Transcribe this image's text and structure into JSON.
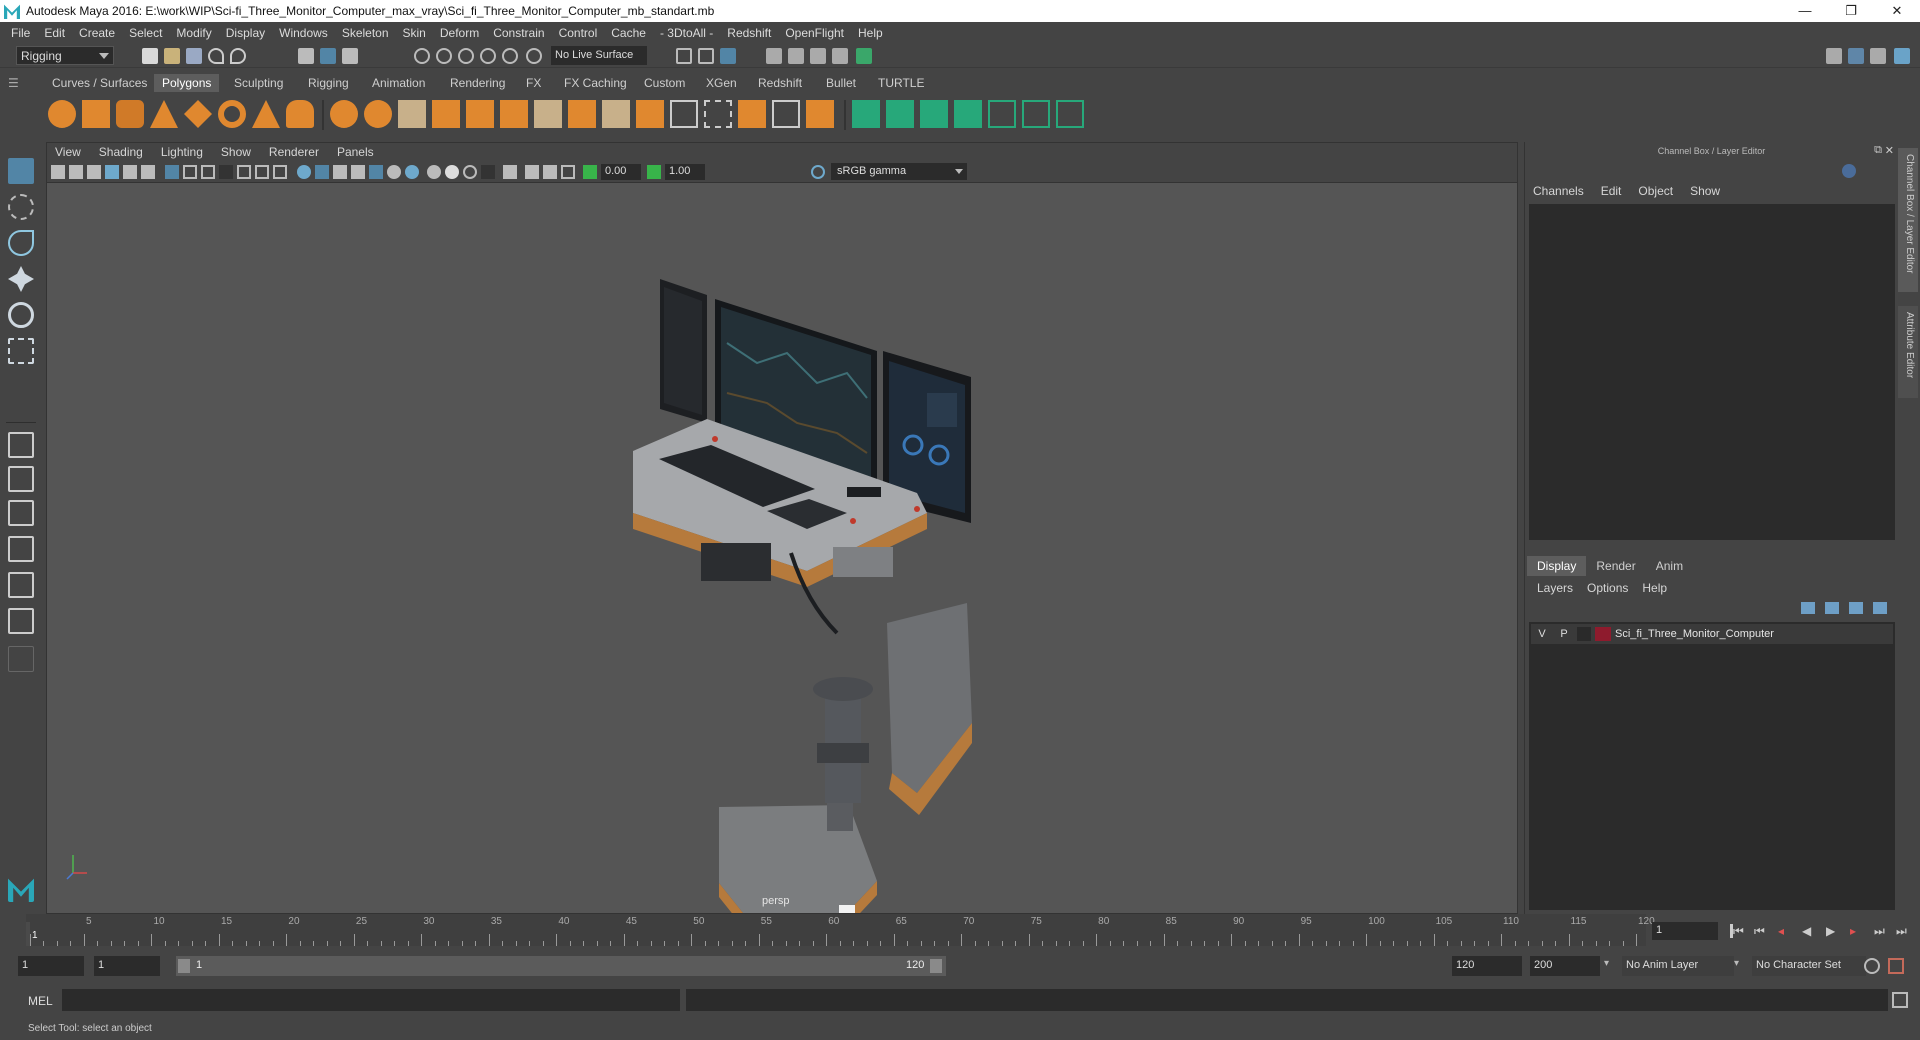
{
  "window": {
    "title": "Autodesk Maya 2016: E:\\work\\WIP\\Sci-fi_Three_Monitor_Computer_max_vray\\Sci_fi_Three_Monitor_Computer_mb_standart.mb",
    "minimize": "—",
    "restore": "❐",
    "close": "✕"
  },
  "menubar": [
    "File",
    "Edit",
    "Create",
    "Select",
    "Modify",
    "Display",
    "Windows",
    "Skeleton",
    "Skin",
    "Deform",
    "Constrain",
    "Control",
    "Cache",
    "- 3DtoAll -",
    "Redshift",
    "OpenFlight",
    "Help"
  ],
  "statusline": {
    "mode": "Rigging",
    "live_surface": "No Live Surface"
  },
  "shelf": {
    "tabs": [
      "Curves / Surfaces",
      "Polygons",
      "Sculpting",
      "Rigging",
      "Animation",
      "Rendering",
      "FX",
      "FX Caching",
      "Custom",
      "XGen",
      "Redshift",
      "Bullet",
      "TURTLE"
    ],
    "active_tab": "Polygons"
  },
  "viewport": {
    "menu": [
      "View",
      "Shading",
      "Lighting",
      "Show",
      "Renderer",
      "Panels"
    ],
    "exposure": "0.00",
    "gamma": "1.00",
    "color_space": "sRGB gamma",
    "camera": "persp"
  },
  "channelbox": {
    "title": "Channel Box / Layer Editor",
    "menu": [
      "Channels",
      "Edit",
      "Object",
      "Show"
    ],
    "side_tabs": [
      "Channel Box / Layer Editor",
      "Attribute Editor"
    ]
  },
  "layer_editor": {
    "tabs": [
      "Display",
      "Render",
      "Anim"
    ],
    "active_tab": "Display",
    "menu": [
      "Layers",
      "Options",
      "Help"
    ],
    "layers": [
      {
        "v": "V",
        "p": "P",
        "name": "Sci_fi_Three_Monitor_Computer",
        "color": "#8e1b2d"
      }
    ]
  },
  "timeslider": {
    "labels": [
      "1",
      "5",
      "10",
      "15",
      "20",
      "25",
      "30",
      "35",
      "40",
      "45",
      "50",
      "55",
      "60",
      "65",
      "70",
      "75",
      "80",
      "85",
      "90",
      "95",
      "100",
      "105",
      "110",
      "115",
      "120"
    ],
    "current_frame": "1"
  },
  "range": {
    "start": "1",
    "inner_start": "1",
    "slider_start": "1",
    "slider_end": "120",
    "end": "120",
    "outer_end": "200",
    "anim_layer": "No Anim Layer",
    "character_set": "No Character Set"
  },
  "commandline": {
    "label": "MEL"
  },
  "helpline": "Select Tool: select an object"
}
